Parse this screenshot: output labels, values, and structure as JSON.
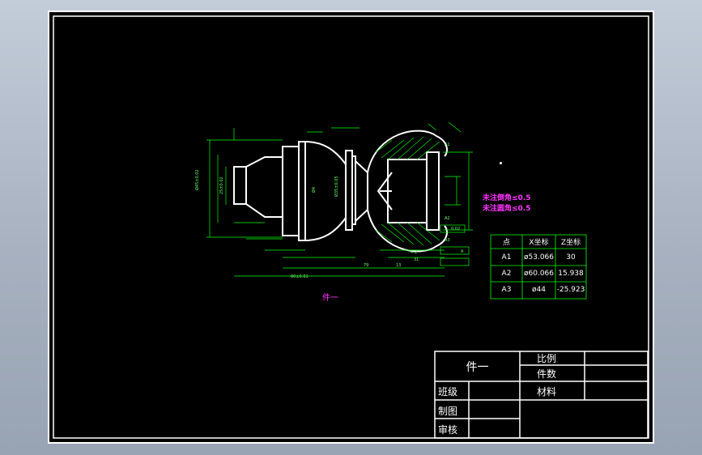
{
  "drawing": {
    "part_label": "件一",
    "notes": [
      "未注倒角≤0.5",
      "未注圆角≤0.5"
    ],
    "dims": [
      "Ø45±0.02",
      "25±0.02",
      "80±0.01",
      "Ø4",
      "Ø35±0.05",
      "4-2",
      "31",
      "13",
      "79",
      "A1",
      "A2",
      "A3",
      "0.02",
      "A"
    ]
  },
  "coord_table": {
    "headers": [
      "点",
      "X坐标",
      "Z坐标"
    ],
    "rows": [
      [
        "A1",
        "ø53.066",
        "30"
      ],
      [
        "A2",
        "ø60.066",
        "15.938"
      ],
      [
        "A3",
        "ø44",
        "-25.923"
      ]
    ]
  },
  "title_block": {
    "part_name": "件一",
    "scale_label": "比例",
    "qty_label": "件数",
    "material_label": "材料",
    "class_label": "班级",
    "drawn_label": "制图",
    "checked_label": "审核"
  },
  "colors": {
    "background": "#000000",
    "frame": "#ffffff",
    "dimension": "#00ff00",
    "note": "#ff33ff"
  }
}
